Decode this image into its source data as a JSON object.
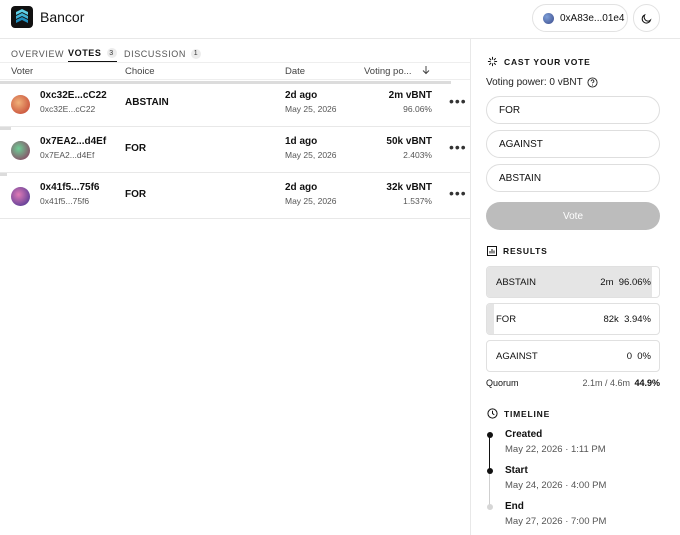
{
  "header": {
    "app_name": "Bancor",
    "wallet_address": "0xA83e...01e4",
    "theme_icon": "moon-icon"
  },
  "tabs": [
    {
      "label": "OVERVIEW",
      "count": null
    },
    {
      "label": "VOTES",
      "count": "3"
    },
    {
      "label": "DISCUSSION",
      "count": "1"
    }
  ],
  "table": {
    "columns": [
      "Voter",
      "Choice",
      "Date",
      "Voting po..."
    ],
    "rows": [
      {
        "address": "0xc32E...cC22",
        "address_sub": "0xc32E...cC22",
        "choice": "ABSTAIN",
        "ago": "2d ago",
        "date": "May 25, 2026",
        "power": "2m vBNT",
        "pct": "96.06%",
        "share": 0.9606
      },
      {
        "address": "0x7EA2...d4Ef",
        "address_sub": "0x7EA2...d4Ef",
        "choice": "FOR",
        "ago": "1d ago",
        "date": "May 25, 2026",
        "power": "50k vBNT",
        "pct": "2.403%",
        "share": 0.02403
      },
      {
        "address": "0x41f5...75f6",
        "address_sub": "0x41f5...75f6",
        "choice": "FOR",
        "ago": "2d ago",
        "date": "May 25, 2026",
        "power": "32k vBNT",
        "pct": "1.537%",
        "share": 0.01537
      }
    ]
  },
  "cast": {
    "title": "CAST YOUR VOTE",
    "voting_power": "Voting power: 0 vBNT",
    "options": [
      "FOR",
      "AGAINST",
      "ABSTAIN"
    ],
    "vote_label": "Vote"
  },
  "results": {
    "title": "RESULTS",
    "items": [
      {
        "label": "ABSTAIN",
        "value": "2m",
        "pct": "96.06%",
        "share": 0.9606
      },
      {
        "label": "FOR",
        "value": "82k",
        "pct": "3.94%",
        "share": 0.0394
      },
      {
        "label": "AGAINST",
        "value": "0",
        "pct": "0%",
        "share": 0
      }
    ],
    "quorum_label": "Quorum",
    "quorum_value": "2.1m / 4.6m",
    "quorum_pct": "44.9%"
  },
  "timeline": {
    "title": "TIMELINE",
    "events": [
      {
        "title": "Created",
        "date": "May 22, 2026 · 1:11 PM"
      },
      {
        "title": "Start",
        "date": "May 24, 2026 · 4:00 PM"
      },
      {
        "title": "End",
        "date": "May 27, 2026 · 7:00 PM"
      }
    ]
  },
  "colors": {
    "accent": "#111111",
    "vote_disabled": "#bcbcbc",
    "result_fill": "#e5e5e5"
  }
}
